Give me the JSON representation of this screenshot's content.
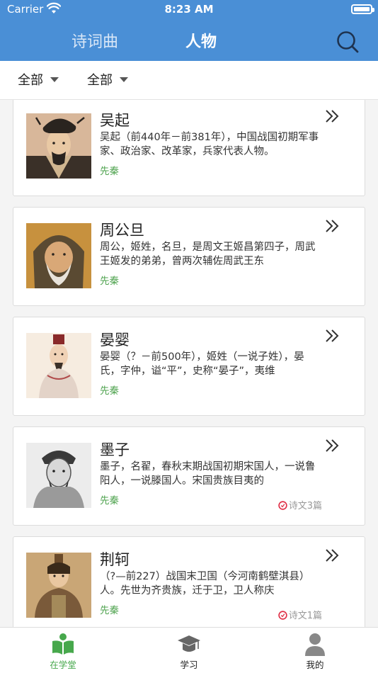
{
  "status_bar": {
    "carrier": "Carrier",
    "time": "8:23 AM"
  },
  "header": {
    "tabs": [
      {
        "label": "诗词曲",
        "active": false
      },
      {
        "label": "人物",
        "active": true
      }
    ],
    "search_icon": "search-icon"
  },
  "filters": [
    {
      "label": "全部"
    },
    {
      "label": "全部"
    }
  ],
  "people": [
    {
      "name": "吴起",
      "desc": "吴起（前440年－前381年），中国战国初期军事家、政治家、改革家，兵家代表人物。",
      "dynasty": "先秦",
      "poem_count": ""
    },
    {
      "name": "周公旦",
      "desc": "周公，姬姓，名旦，是周文王姬昌第四子，周武王姬发的弟弟，曾两次辅佐周武王东",
      "dynasty": "先秦",
      "poem_count": ""
    },
    {
      "name": "晏婴",
      "desc": "晏婴（？－前500年），姬姓（一说子姓），晏氏，字仲，谥“平”，史称“晏子”，夷维",
      "dynasty": "先秦",
      "poem_count": ""
    },
    {
      "name": "墨子",
      "desc": "墨子，名翟，春秋末期战国初期宋国人，一说鲁阳人，一说滕国人。宋国贵族目夷的",
      "dynasty": "先秦",
      "poem_count": "诗文3篇"
    },
    {
      "name": "荆轲",
      "desc": "（?—前227）战国末卫国（今河南鹤壁淇县）人。先世为齐贵族，迁于卫，卫人称庆",
      "dynasty": "先秦",
      "poem_count": "诗文1篇"
    }
  ],
  "tabbar": [
    {
      "label": "在学堂",
      "icon": "book-icon",
      "active": true
    },
    {
      "label": "学习",
      "icon": "graduation-cap-icon",
      "active": false
    },
    {
      "label": "我的",
      "icon": "person-icon",
      "active": false
    }
  ],
  "colors": {
    "header_bg": "#4a8fd6",
    "dynasty_green": "#4fa34f",
    "tab_active_green": "#47a84c",
    "poem_clock_red": "#e0334a"
  }
}
